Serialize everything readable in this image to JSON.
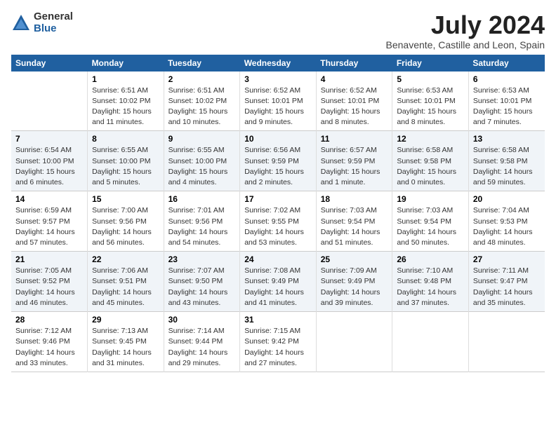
{
  "header": {
    "logo_general": "General",
    "logo_blue": "Blue",
    "month_year": "July 2024",
    "location": "Benavente, Castille and Leon, Spain"
  },
  "days_of_week": [
    "Sunday",
    "Monday",
    "Tuesday",
    "Wednesday",
    "Thursday",
    "Friday",
    "Saturday"
  ],
  "weeks": [
    [
      {
        "day": "",
        "info": ""
      },
      {
        "day": "1",
        "info": "Sunrise: 6:51 AM\nSunset: 10:02 PM\nDaylight: 15 hours\nand 11 minutes."
      },
      {
        "day": "2",
        "info": "Sunrise: 6:51 AM\nSunset: 10:02 PM\nDaylight: 15 hours\nand 10 minutes."
      },
      {
        "day": "3",
        "info": "Sunrise: 6:52 AM\nSunset: 10:01 PM\nDaylight: 15 hours\nand 9 minutes."
      },
      {
        "day": "4",
        "info": "Sunrise: 6:52 AM\nSunset: 10:01 PM\nDaylight: 15 hours\nand 8 minutes."
      },
      {
        "day": "5",
        "info": "Sunrise: 6:53 AM\nSunset: 10:01 PM\nDaylight: 15 hours\nand 8 minutes."
      },
      {
        "day": "6",
        "info": "Sunrise: 6:53 AM\nSunset: 10:01 PM\nDaylight: 15 hours\nand 7 minutes."
      }
    ],
    [
      {
        "day": "7",
        "info": "Sunrise: 6:54 AM\nSunset: 10:00 PM\nDaylight: 15 hours\nand 6 minutes."
      },
      {
        "day": "8",
        "info": "Sunrise: 6:55 AM\nSunset: 10:00 PM\nDaylight: 15 hours\nand 5 minutes."
      },
      {
        "day": "9",
        "info": "Sunrise: 6:55 AM\nSunset: 10:00 PM\nDaylight: 15 hours\nand 4 minutes."
      },
      {
        "day": "10",
        "info": "Sunrise: 6:56 AM\nSunset: 9:59 PM\nDaylight: 15 hours\nand 2 minutes."
      },
      {
        "day": "11",
        "info": "Sunrise: 6:57 AM\nSunset: 9:59 PM\nDaylight: 15 hours\nand 1 minute."
      },
      {
        "day": "12",
        "info": "Sunrise: 6:58 AM\nSunset: 9:58 PM\nDaylight: 15 hours\nand 0 minutes."
      },
      {
        "day": "13",
        "info": "Sunrise: 6:58 AM\nSunset: 9:58 PM\nDaylight: 14 hours\nand 59 minutes."
      }
    ],
    [
      {
        "day": "14",
        "info": "Sunrise: 6:59 AM\nSunset: 9:57 PM\nDaylight: 14 hours\nand 57 minutes."
      },
      {
        "day": "15",
        "info": "Sunrise: 7:00 AM\nSunset: 9:56 PM\nDaylight: 14 hours\nand 56 minutes."
      },
      {
        "day": "16",
        "info": "Sunrise: 7:01 AM\nSunset: 9:56 PM\nDaylight: 14 hours\nand 54 minutes."
      },
      {
        "day": "17",
        "info": "Sunrise: 7:02 AM\nSunset: 9:55 PM\nDaylight: 14 hours\nand 53 minutes."
      },
      {
        "day": "18",
        "info": "Sunrise: 7:03 AM\nSunset: 9:54 PM\nDaylight: 14 hours\nand 51 minutes."
      },
      {
        "day": "19",
        "info": "Sunrise: 7:03 AM\nSunset: 9:54 PM\nDaylight: 14 hours\nand 50 minutes."
      },
      {
        "day": "20",
        "info": "Sunrise: 7:04 AM\nSunset: 9:53 PM\nDaylight: 14 hours\nand 48 minutes."
      }
    ],
    [
      {
        "day": "21",
        "info": "Sunrise: 7:05 AM\nSunset: 9:52 PM\nDaylight: 14 hours\nand 46 minutes."
      },
      {
        "day": "22",
        "info": "Sunrise: 7:06 AM\nSunset: 9:51 PM\nDaylight: 14 hours\nand 45 minutes."
      },
      {
        "day": "23",
        "info": "Sunrise: 7:07 AM\nSunset: 9:50 PM\nDaylight: 14 hours\nand 43 minutes."
      },
      {
        "day": "24",
        "info": "Sunrise: 7:08 AM\nSunset: 9:49 PM\nDaylight: 14 hours\nand 41 minutes."
      },
      {
        "day": "25",
        "info": "Sunrise: 7:09 AM\nSunset: 9:49 PM\nDaylight: 14 hours\nand 39 minutes."
      },
      {
        "day": "26",
        "info": "Sunrise: 7:10 AM\nSunset: 9:48 PM\nDaylight: 14 hours\nand 37 minutes."
      },
      {
        "day": "27",
        "info": "Sunrise: 7:11 AM\nSunset: 9:47 PM\nDaylight: 14 hours\nand 35 minutes."
      }
    ],
    [
      {
        "day": "28",
        "info": "Sunrise: 7:12 AM\nSunset: 9:46 PM\nDaylight: 14 hours\nand 33 minutes."
      },
      {
        "day": "29",
        "info": "Sunrise: 7:13 AM\nSunset: 9:45 PM\nDaylight: 14 hours\nand 31 minutes."
      },
      {
        "day": "30",
        "info": "Sunrise: 7:14 AM\nSunset: 9:44 PM\nDaylight: 14 hours\nand 29 minutes."
      },
      {
        "day": "31",
        "info": "Sunrise: 7:15 AM\nSunset: 9:42 PM\nDaylight: 14 hours\nand 27 minutes."
      },
      {
        "day": "",
        "info": ""
      },
      {
        "day": "",
        "info": ""
      },
      {
        "day": "",
        "info": ""
      }
    ]
  ]
}
